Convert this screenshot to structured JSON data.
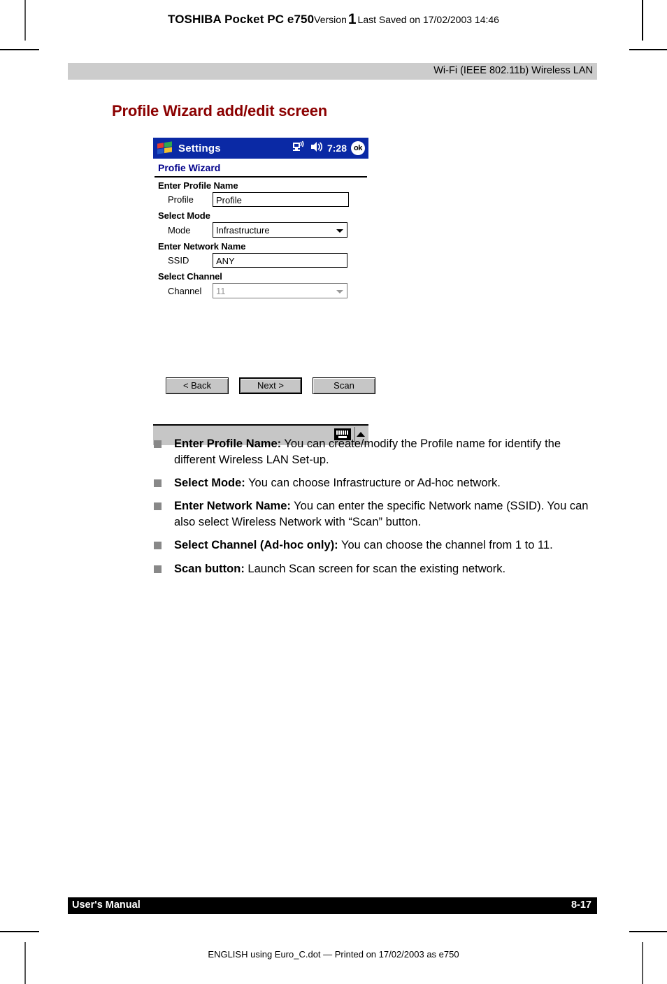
{
  "running_head": {
    "model": "TOSHIBA Pocket PC e750",
    "version_word": "Version",
    "version_number": "1",
    "last_saved": "Last Saved on 17/02/2003 14:46"
  },
  "chapter_bar": {
    "label": "Wi-Fi (IEEE 802.11b) Wireless LAN",
    "background": "#cccccc"
  },
  "section": {
    "heading": "Profile Wizard add/edit screen",
    "color": "#8b0000"
  },
  "pda": {
    "titlebar": {
      "start_icon": "windows-flag-icon",
      "title": "Settings",
      "connectivity_icon": "network-connection-icon",
      "volume_icon": "speaker-icon",
      "clock": "7:28",
      "ok_label": "ok",
      "background": "#0a29a5"
    },
    "subtitle": "Profie Wizard",
    "groups": [
      {
        "group_label": "Enter Profile Name",
        "field_label": "Profile",
        "control": "textbox",
        "value": "Profile"
      },
      {
        "group_label": "Select Mode",
        "field_label": "Mode",
        "control": "combobox",
        "value": "Infrastructure"
      },
      {
        "group_label": "Enter Network Name",
        "field_label": "SSID",
        "control": "textbox",
        "value": "ANY"
      },
      {
        "group_label": "Select Channel",
        "field_label": "Channel",
        "control": "combobox-disabled",
        "value": "11"
      }
    ],
    "buttons": {
      "back": "< Back",
      "next": "Next >",
      "scan": "Scan"
    },
    "taskbar": {
      "keyboard_icon": "soft-keyboard-icon",
      "expand_icon": "chevron-up-icon"
    }
  },
  "bullets": [
    {
      "lead": "Enter Profile Name:",
      "body": " You can create/modify the Profile name for identify the different Wireless LAN Set-up."
    },
    {
      "lead": "Select Mode:",
      "body": " You can choose Infrastructure or Ad-hoc network."
    },
    {
      "lead": "Enter Network Name:",
      "body": " You can enter the specific Network name (SSID). You can also select Wireless Network with “Scan” button."
    },
    {
      "lead": "Select Channel (Ad-hoc only):",
      "body": " You can choose the channel from 1 to 11."
    },
    {
      "lead": "Scan button:",
      "body": " Launch Scan screen for scan the existing network."
    }
  ],
  "footer": {
    "left": "User's Manual",
    "page": "8-17",
    "print_line": "ENGLISH using Euro_C.dot — Printed on 17/02/2003 as e750"
  }
}
